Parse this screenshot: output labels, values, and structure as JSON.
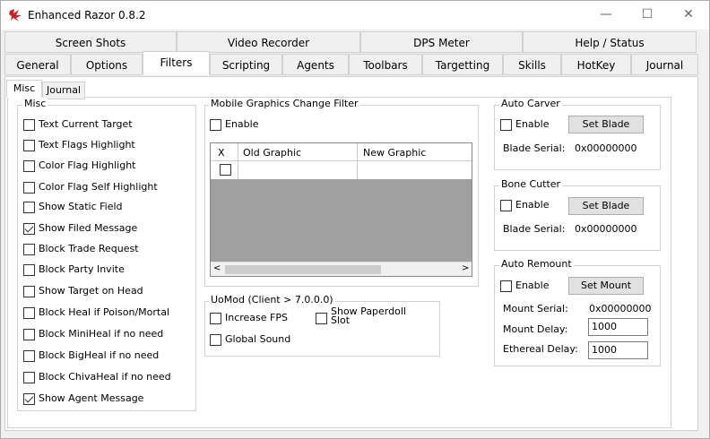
{
  "window": {
    "title": "Enhanced Razor 0.8.2",
    "minimize": "—",
    "maximize": "☐",
    "close": "✕"
  },
  "tabs_row1": [
    "Screen Shots",
    "Video Recorder",
    "DPS Meter",
    "Help / Status"
  ],
  "tabs_row2": [
    "General",
    "Options",
    "Filters",
    "Scripting",
    "Agents",
    "Toolbars",
    "Targetting",
    "Skills",
    "HotKey",
    "Journal"
  ],
  "subtabs": [
    "Misc",
    "Journal"
  ],
  "misc": {
    "title": "Misc",
    "items": [
      {
        "label": "Text Current Target",
        "checked": false
      },
      {
        "label": "Text Flags Highlight",
        "checked": false
      },
      {
        "label": "Color Flag Highlight",
        "checked": false
      },
      {
        "label": "Color Flag Self Highlight",
        "checked": false
      },
      {
        "label": "Show Static Field",
        "checked": false
      },
      {
        "label": "Show Filed Message",
        "checked": true
      },
      {
        "label": "Block Trade Request",
        "checked": false
      },
      {
        "label": "Block Party Invite",
        "checked": false
      },
      {
        "label": "Show Target on Head",
        "checked": false
      },
      {
        "label": "Block Heal if Poison/Mortal",
        "checked": false
      },
      {
        "label": "Block MiniHeal if no need",
        "checked": false
      },
      {
        "label": "Block BigHeal if no need",
        "checked": false
      },
      {
        "label": "Block ChivaHeal if no need",
        "checked": false
      },
      {
        "label": "Show Agent Message",
        "checked": true
      }
    ]
  },
  "mobile": {
    "title": "Mobile Graphics Change Filter",
    "enable": "Enable",
    "col_x": "X",
    "col_old": "Old Graphic",
    "col_new": "New Graphic"
  },
  "uomod": {
    "title": "UoMod (Client > 7.0.0.0)",
    "increase_fps": "Increase FPS",
    "global_sound": "Global Sound",
    "show_paperdoll": "Show Paperdoll Slot"
  },
  "auto_carver": {
    "title": "Auto Carver",
    "enable": "Enable",
    "button": "Set Blade",
    "serial_label": "Blade Serial:",
    "serial_value": "0x00000000"
  },
  "bone_cutter": {
    "title": "Bone Cutter",
    "enable": "Enable",
    "button": "Set Blade",
    "serial_label": "Blade Serial:",
    "serial_value": "0x00000000"
  },
  "auto_remount": {
    "title": "Auto Remount",
    "enable": "Enable",
    "button": "Set Mount",
    "serial_label": "Mount Serial:",
    "serial_value": "0x00000000",
    "delay_label": "Mount Delay:",
    "delay_value": "1000",
    "ethereal_label": "Ethereal Delay:",
    "ethereal_value": "1000"
  }
}
